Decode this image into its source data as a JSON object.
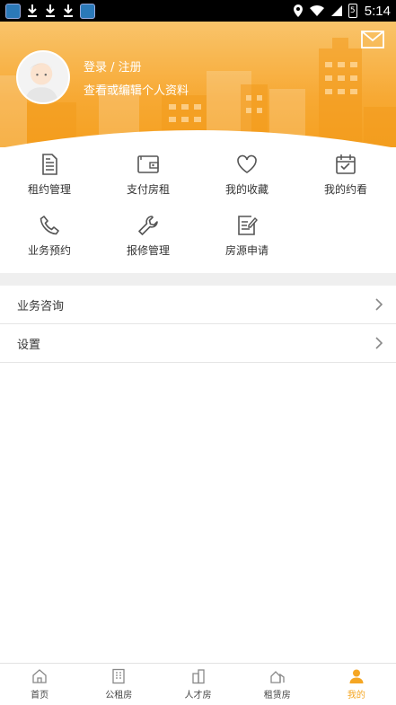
{
  "status_bar": {
    "time": "5:14",
    "battery_level": "5"
  },
  "header": {
    "login_label": "登录 / 注册",
    "profile_subtitle": "查看或编辑个人资料"
  },
  "grid": {
    "items": [
      {
        "label": "租约管理",
        "icon": "document-icon"
      },
      {
        "label": "支付房租",
        "icon": "wallet-icon"
      },
      {
        "label": "我的收藏",
        "icon": "heart-icon"
      },
      {
        "label": "我的约看",
        "icon": "calendar-check-icon"
      },
      {
        "label": "业务预约",
        "icon": "phone-icon"
      },
      {
        "label": "报修管理",
        "icon": "wrench-icon"
      },
      {
        "label": "房源申请",
        "icon": "edit-document-icon"
      }
    ]
  },
  "menu": {
    "items": [
      {
        "label": "业务咨询"
      },
      {
        "label": "设置"
      }
    ]
  },
  "bottom_nav": {
    "items": [
      {
        "label": "首页",
        "icon": "home-icon"
      },
      {
        "label": "公租房",
        "icon": "building-icon"
      },
      {
        "label": "人才房",
        "icon": "tower-icon"
      },
      {
        "label": "租赁房",
        "icon": "house-icon"
      },
      {
        "label": "我的",
        "icon": "person-icon",
        "active": true
      }
    ]
  },
  "colors": {
    "accent": "#f5a623",
    "header_top": "#f9c46b",
    "header_bottom": "#f5a020"
  }
}
